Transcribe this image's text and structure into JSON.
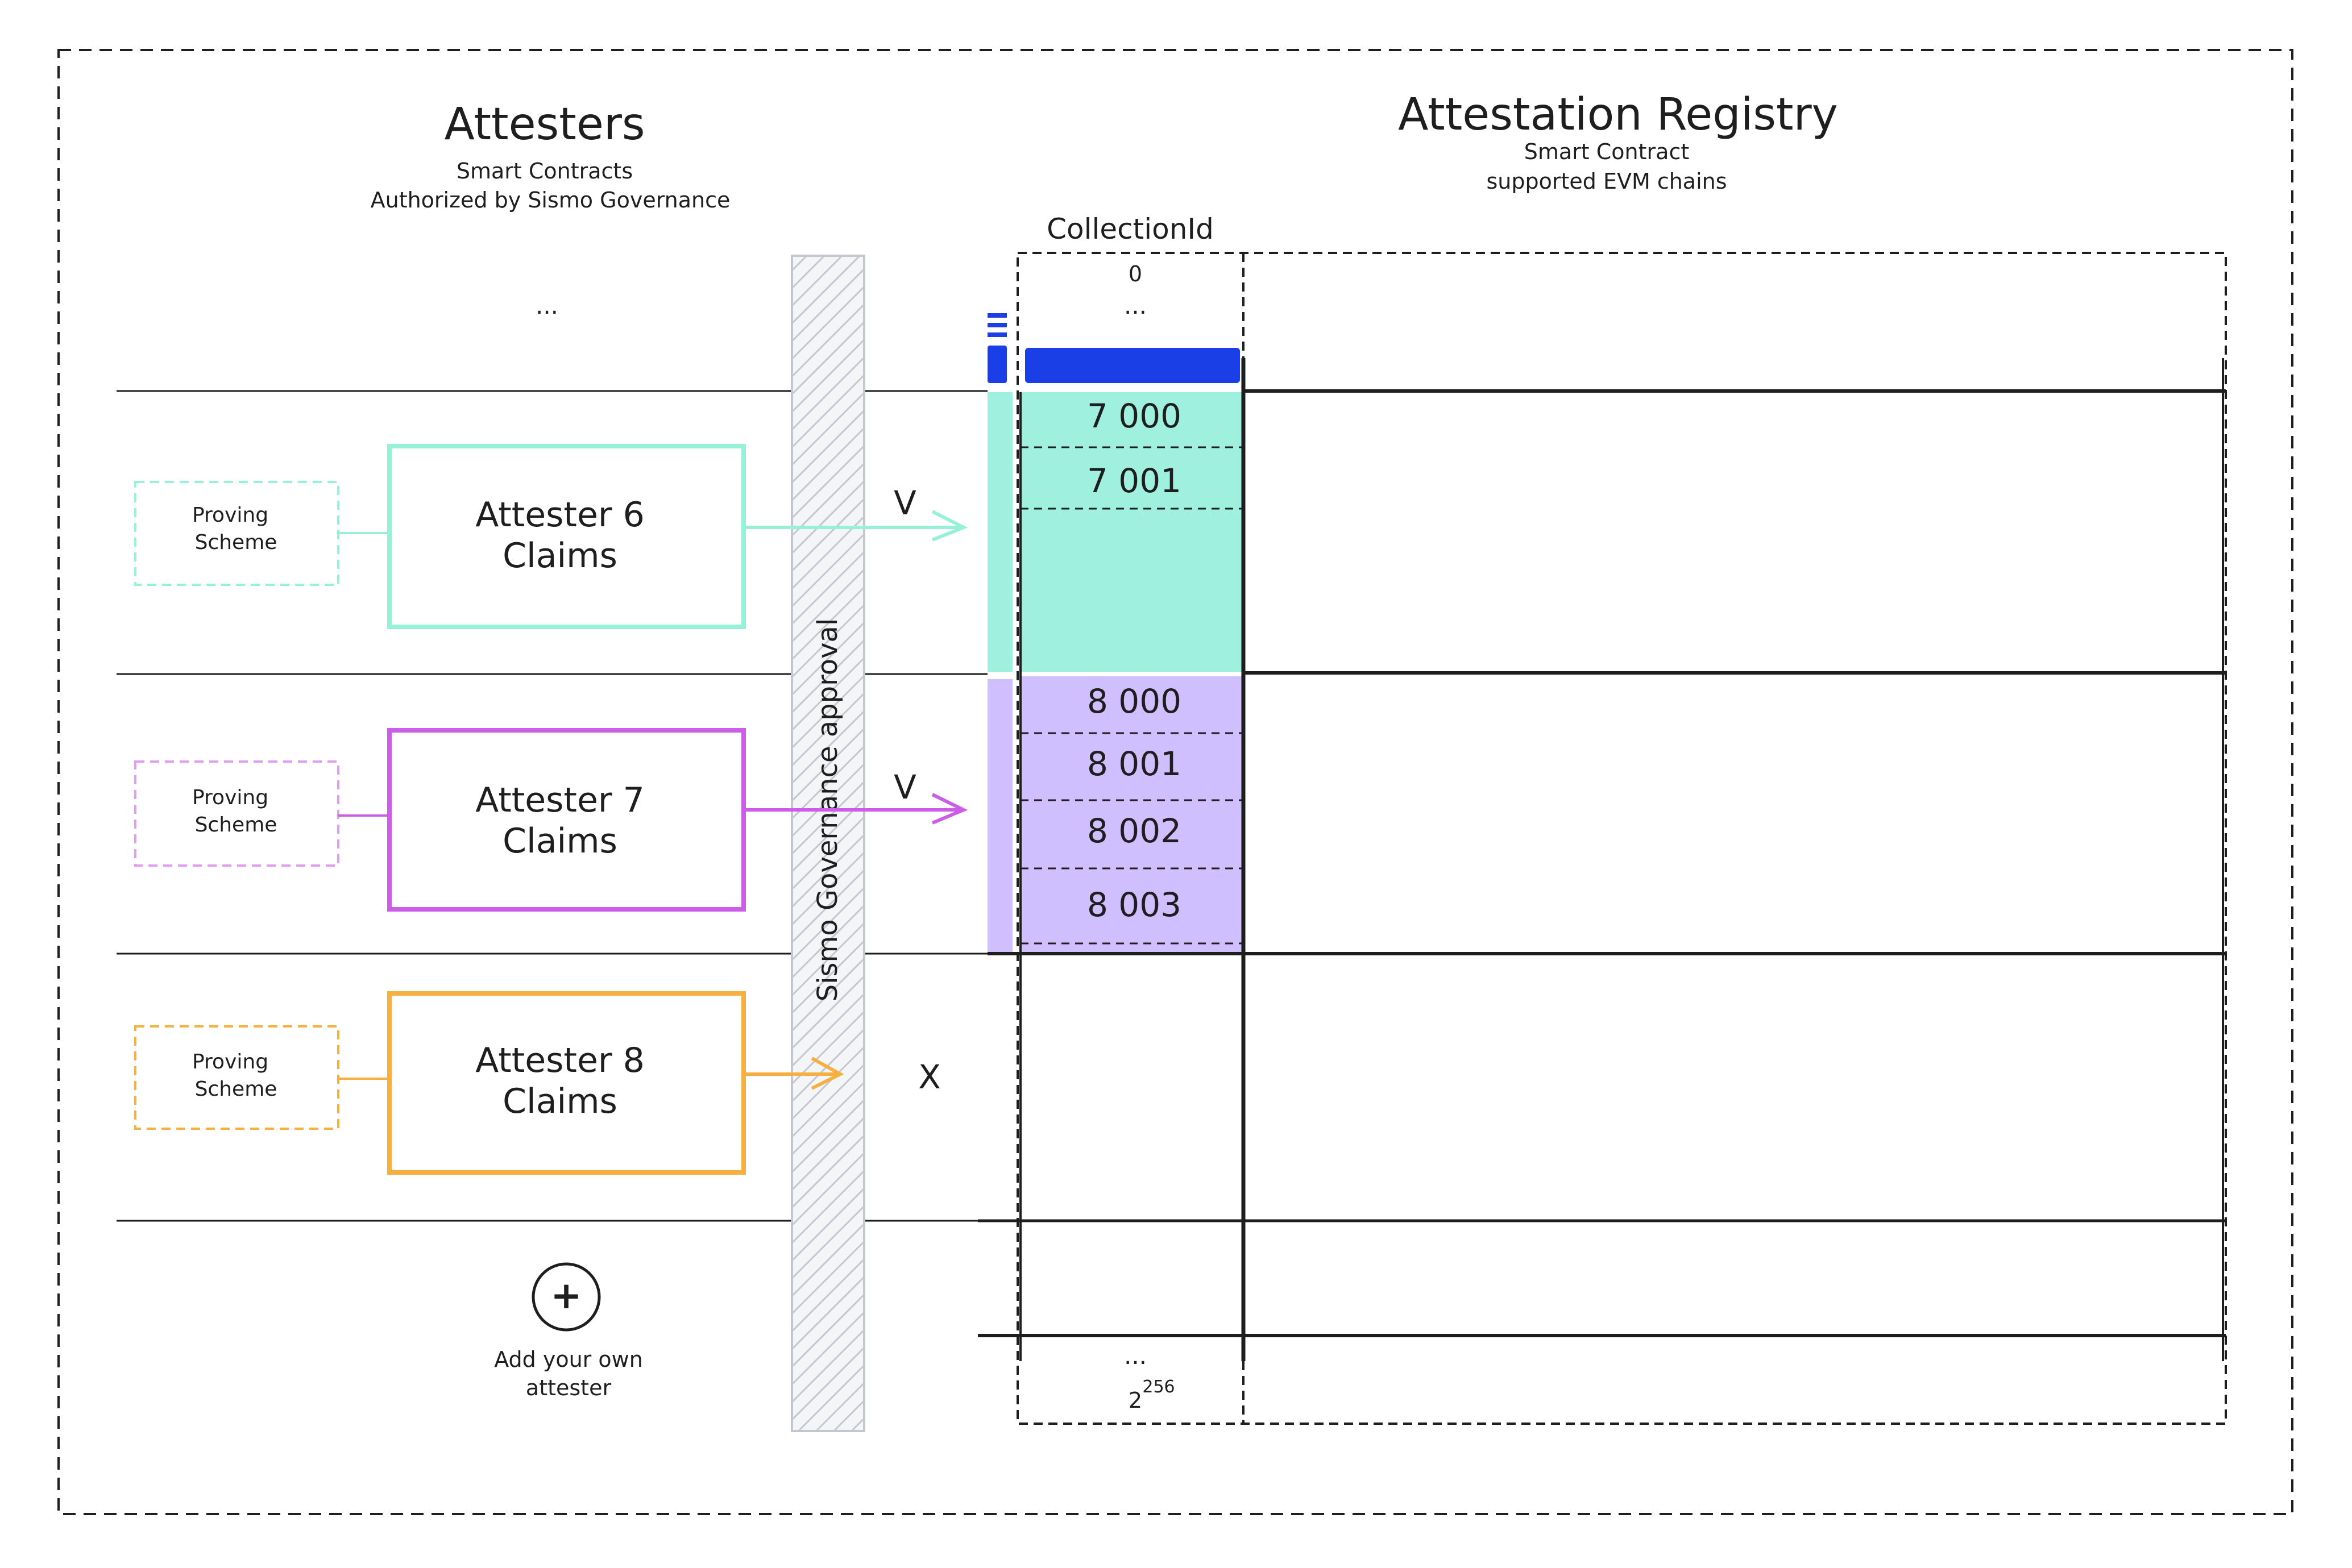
{
  "attesters": {
    "title": "Attesters",
    "subtitle1": "Smart Contracts",
    "subtitle2": "Authorized by Sismo Governance",
    "top_ellipsis": "...",
    "items": [
      {
        "title": "Attester 6",
        "subtitle": "Claims",
        "scheme1": "Proving",
        "scheme2": "Scheme",
        "color": "#63e6be",
        "mark": "V"
      },
      {
        "title": "Attester 7",
        "subtitle": "Claims",
        "scheme1": "Proving",
        "scheme2": "Scheme",
        "color": "#cc5de8",
        "mark": "V"
      },
      {
        "title": "Attester 8",
        "subtitle": "Claims",
        "scheme1": "Proving",
        "scheme2": "Scheme",
        "color": "#f08c00",
        "mark": "X"
      }
    ],
    "add_symbol": "+",
    "add_label1": "Add your own",
    "add_label2": "attester"
  },
  "governance": {
    "label": "Sismo Governance approval"
  },
  "registry": {
    "title": "Attestation Registry",
    "subtitle1": "Smart Contract",
    "subtitle2": "supported EVM chains",
    "column_header": "CollectionId",
    "top_zero": "0",
    "top_ellipsis": "...",
    "ids_7": [
      "7 000",
      "7 001"
    ],
    "ids_8": [
      "8 000",
      "8 001",
      "8 002",
      "8 003"
    ],
    "bottom_ellipsis": "...",
    "bottom_base": "2",
    "bottom_exp": "256"
  },
  "colors": {
    "teal_fill": "#9ff0de",
    "teal_stroke": "#96f2d7",
    "purple_fill": "#d0bfff",
    "purple_stroke": "#cc5de8",
    "orange": "#f5b041",
    "blue": "#1a3fe6",
    "ink": "#1e1e1e"
  }
}
